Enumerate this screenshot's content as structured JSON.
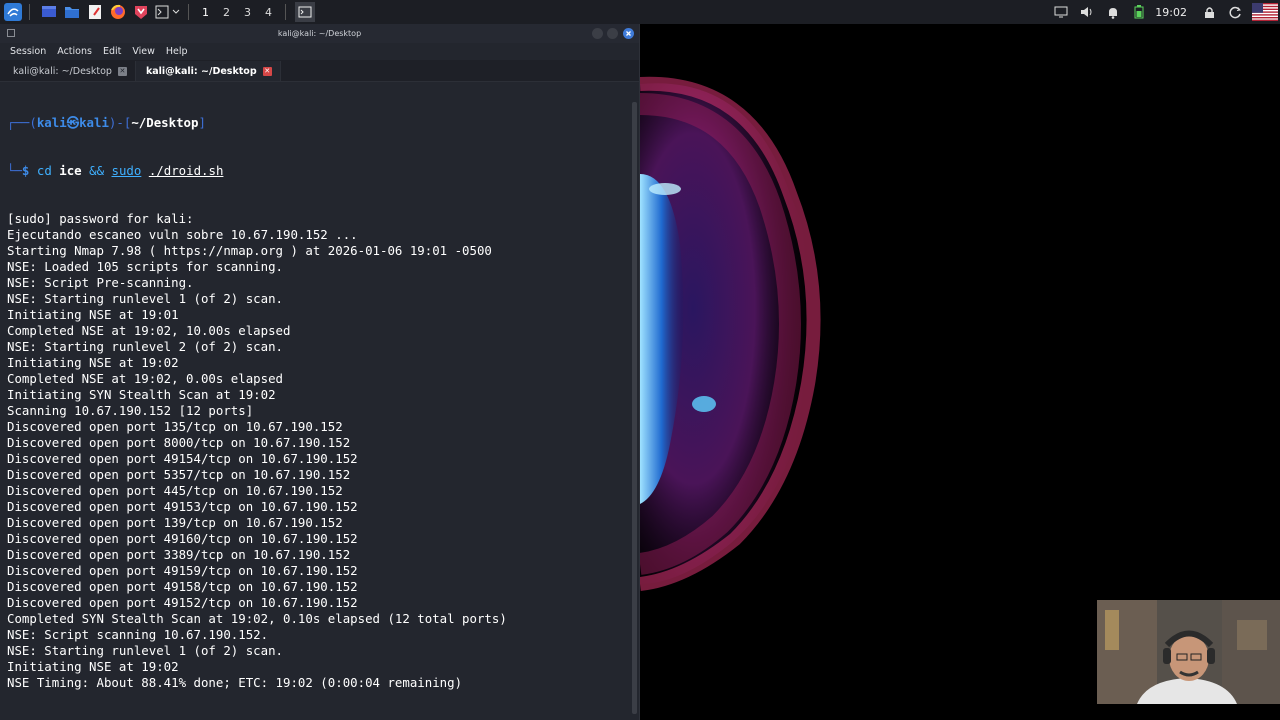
{
  "panel": {
    "workspaces": [
      "1",
      "2",
      "3",
      "4"
    ],
    "clock": "19:02"
  },
  "window": {
    "title": "kali@kali: ~/Desktop",
    "menu": [
      "Session",
      "Actions",
      "Edit",
      "View",
      "Help"
    ],
    "tabs": [
      {
        "label": "kali@kali: ~/Desktop",
        "active": false
      },
      {
        "label": "kali@kali: ~/Desktop",
        "active": true
      }
    ]
  },
  "prompt": {
    "frame_open": "┌──(",
    "user": "kali",
    "at": "㉿",
    "host": "kali",
    "frame_mid": ")-[",
    "dir": "~/Desktop",
    "frame_close": "]",
    "frame_bottom": "└─",
    "dollar": "$",
    "cmd": "cd",
    "arg": "ice",
    "op": "&&",
    "sudo": "sudo",
    "script": "./droid.sh"
  },
  "output": [
    "[sudo] password for kali:",
    "Ejecutando escaneo vuln sobre 10.67.190.152 ...",
    "Starting Nmap 7.98 ( https://nmap.org ) at 2026-01-06 19:01 -0500",
    "NSE: Loaded 105 scripts for scanning.",
    "NSE: Script Pre-scanning.",
    "NSE: Starting runlevel 1 (of 2) scan.",
    "Initiating NSE at 19:01",
    "Completed NSE at 19:02, 10.00s elapsed",
    "NSE: Starting runlevel 2 (of 2) scan.",
    "Initiating NSE at 19:02",
    "Completed NSE at 19:02, 0.00s elapsed",
    "Initiating SYN Stealth Scan at 19:02",
    "Scanning 10.67.190.152 [12 ports]",
    "Discovered open port 135/tcp on 10.67.190.152",
    "Discovered open port 8000/tcp on 10.67.190.152",
    "Discovered open port 49154/tcp on 10.67.190.152",
    "Discovered open port 5357/tcp on 10.67.190.152",
    "Discovered open port 445/tcp on 10.67.190.152",
    "Discovered open port 49153/tcp on 10.67.190.152",
    "Discovered open port 139/tcp on 10.67.190.152",
    "Discovered open port 49160/tcp on 10.67.190.152",
    "Discovered open port 3389/tcp on 10.67.190.152",
    "Discovered open port 49159/tcp on 10.67.190.152",
    "Discovered open port 49158/tcp on 10.67.190.152",
    "Discovered open port 49152/tcp on 10.67.190.152",
    "Completed SYN Stealth Scan at 19:02, 0.10s elapsed (12 total ports)",
    "NSE: Script scanning 10.67.190.152.",
    "NSE: Starting runlevel 1 (of 2) scan.",
    "Initiating NSE at 19:02",
    "NSE Timing: About 88.41% done; ETC: 19:02 (0:00:04 remaining)"
  ],
  "colors": {
    "terminal_bg": "#23262e",
    "prompt_blue": "#3d8be8",
    "command_cyan": "#3fb0ff",
    "close_red": "#d64747"
  },
  "icons": {
    "launcher": "kali-menu-icon",
    "files": "file-manager-icon",
    "browser": "firefox-icon"
  }
}
